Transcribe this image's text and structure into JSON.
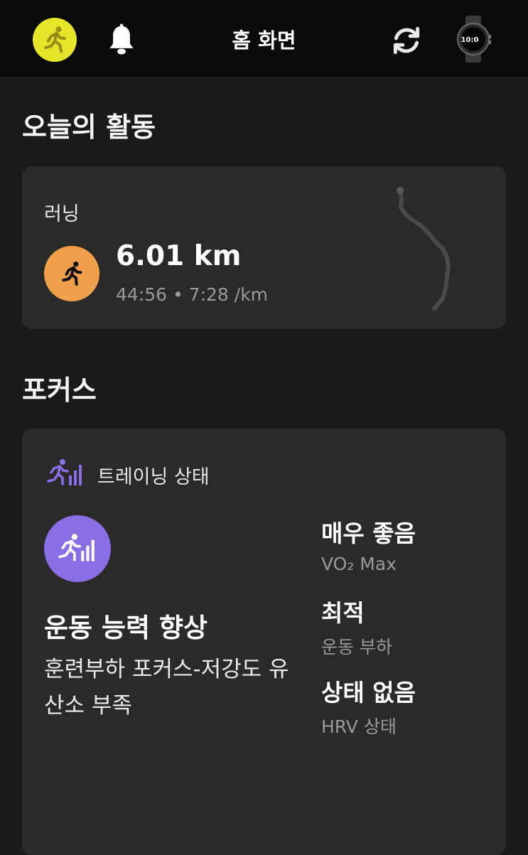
{
  "header": {
    "title": "홈 화면",
    "avatar_icon": "running-person-icon",
    "notification_icon": "bell-icon",
    "sync_icon": "sync-icon",
    "device_icon": "watch-icon",
    "device_watch_time": "10:0"
  },
  "today": {
    "section_title": "오늘의 활동",
    "activity": {
      "type_label": "러닝",
      "distance": "6.01 km",
      "meta": "44:56 • 7:28 /km",
      "icon": "running-icon",
      "accent_color": "#f0a04b"
    }
  },
  "focus": {
    "section_title": "포커스",
    "card": {
      "header_label": "트레이닝 상태",
      "header_icon": "training-status-icon",
      "status_title": "운동 능력 향상",
      "status_description": "훈련부하 포커스-저강도 유산소 부족",
      "badge_color": "#8a6ee6",
      "metrics": [
        {
          "value": "매우 좋음",
          "label": "VO₂ Max"
        },
        {
          "value": "최적",
          "label": "운동 부하"
        },
        {
          "value": "상태 없음",
          "label": "HRV 상태"
        }
      ]
    }
  }
}
